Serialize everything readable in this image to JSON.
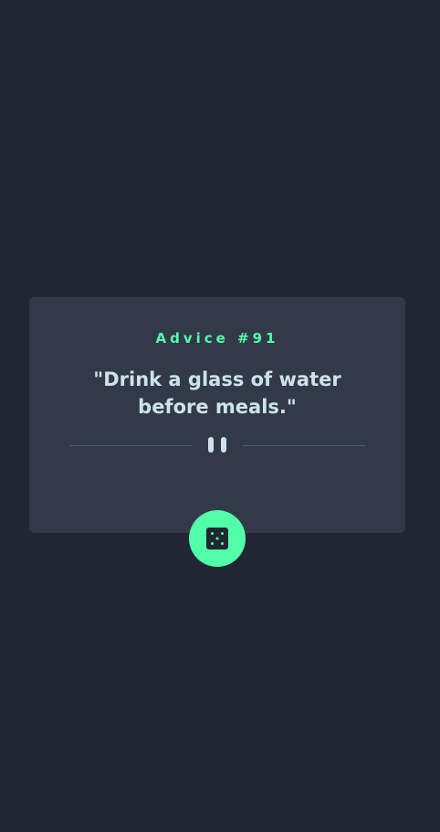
{
  "advice": {
    "id_label": "Advice #91",
    "text": "\"Drink a glass of water before meals.\""
  },
  "icons": {
    "divider": "pause-icon",
    "button": "dice-icon"
  },
  "colors": {
    "background": "#202632",
    "card": "#323a49",
    "accent": "#52ffa8",
    "text": "#cee3e9",
    "divider_line": "#4f5d74"
  }
}
